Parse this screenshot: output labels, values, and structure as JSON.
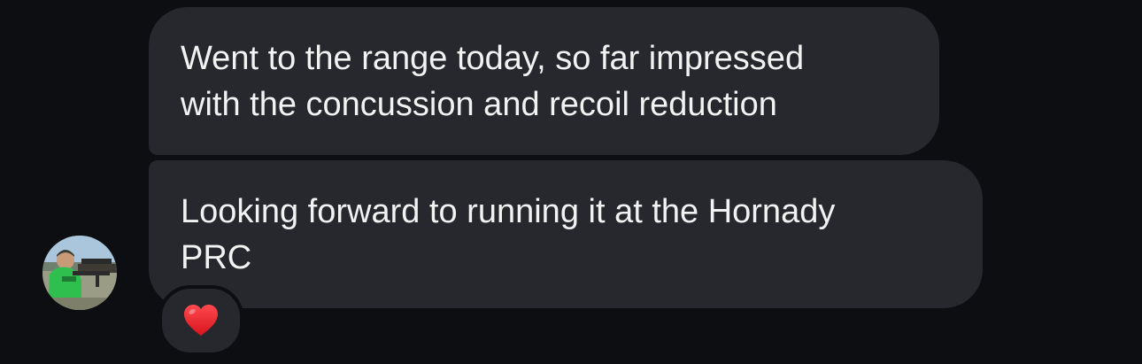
{
  "messages": [
    {
      "lines": [
        "Went to the range today, so far impressed",
        "with the concussion and recoil reduction"
      ]
    },
    {
      "lines": [
        "Looking forward to running it at the Hornady",
        "PRC"
      ]
    }
  ],
  "reaction": {
    "icon": "heart-icon",
    "color": "#e8262d"
  },
  "avatar": {
    "icon": "user-avatar-photo"
  },
  "colors": {
    "background": "#0c0e12",
    "bubble": "#26282d",
    "text": "#f2f2f2"
  }
}
